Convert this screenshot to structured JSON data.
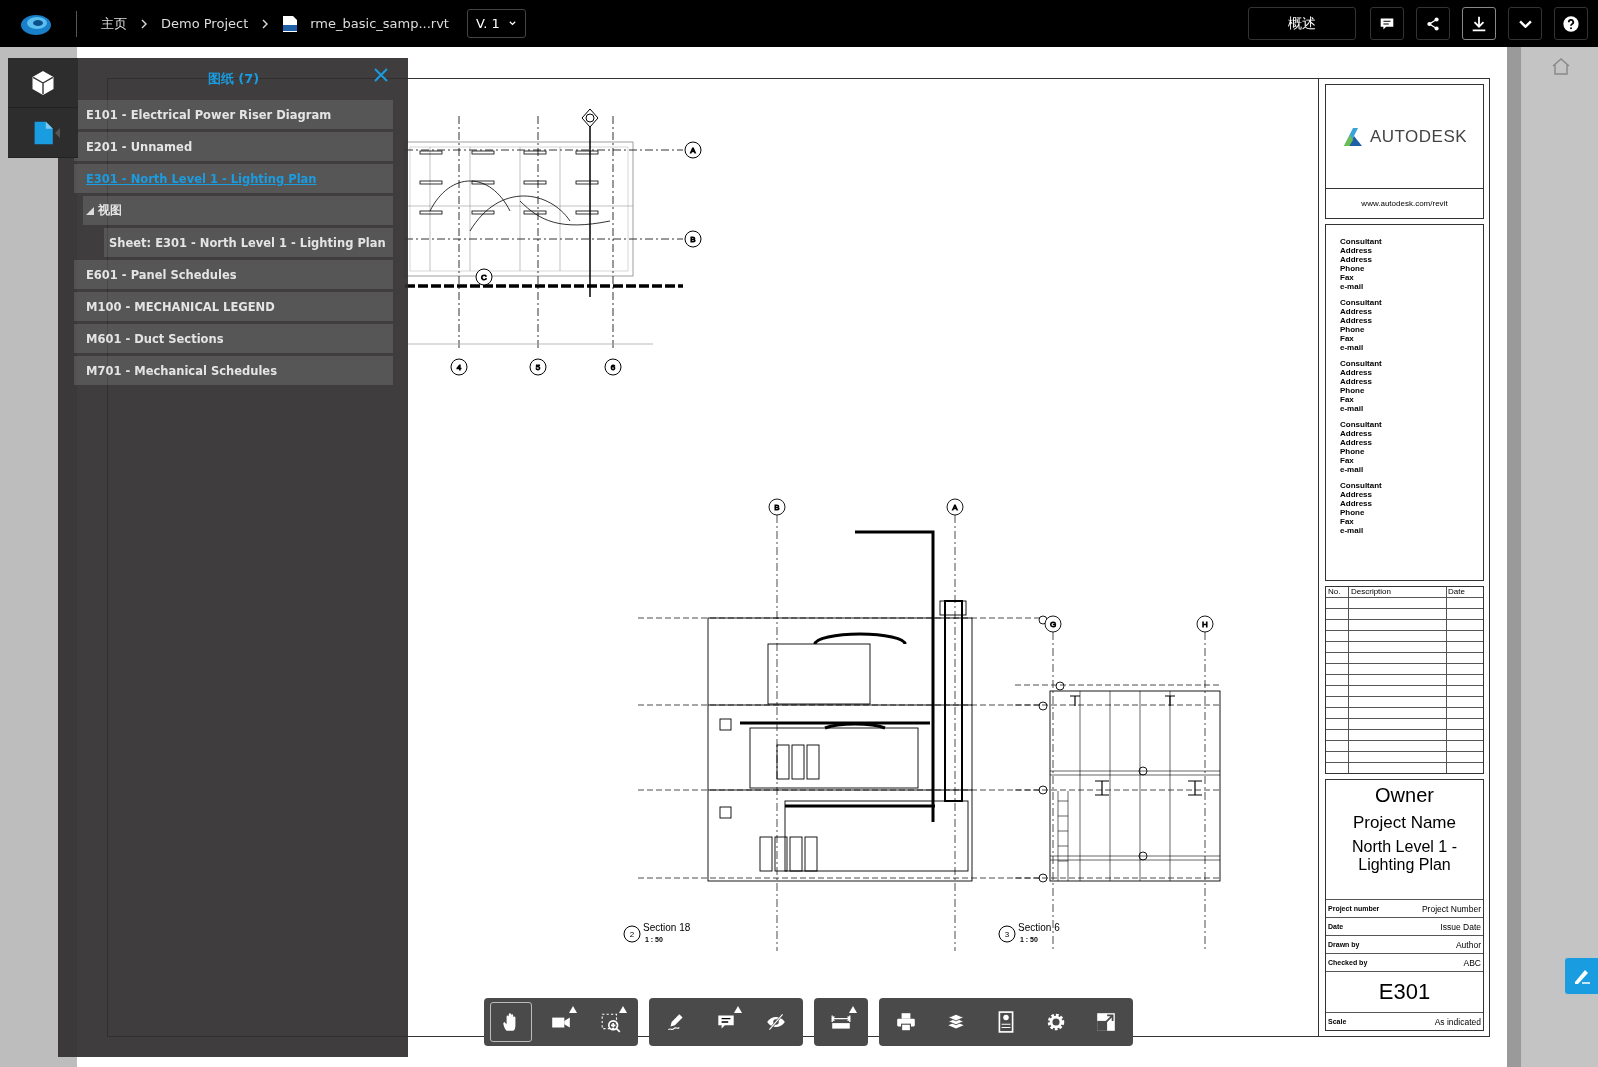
{
  "top_bar": {
    "breadcrumb": [
      {
        "kind": "link",
        "label": "主页"
      },
      {
        "kind": "link",
        "label": "Demo Project"
      },
      {
        "kind": "file",
        "label": "rme_basic_samp...rvt"
      }
    ],
    "version": "V. 1",
    "overview_button": "概述",
    "actions": [
      {
        "kind": "comment",
        "selected": false
      },
      {
        "kind": "share",
        "selected": false
      },
      {
        "kind": "download",
        "selected": true
      },
      {
        "kind": "more",
        "selected": false
      },
      {
        "kind": "help",
        "selected": false
      }
    ]
  },
  "side_tabs": [
    {
      "kind": "model",
      "selected": false
    },
    {
      "kind": "sheets",
      "selected": true
    }
  ],
  "sheets_panel": {
    "title": "图纸 (7)",
    "items": [
      {
        "label": "E101 - Electrical Power Riser Diagram",
        "selected": false
      },
      {
        "label": "E201 - Unnamed",
        "selected": false
      },
      {
        "label": "E301 - North Level 1 - Lighting Plan",
        "selected": true,
        "children": [
          {
            "label": "视图",
            "expanded": true,
            "children": [
              {
                "label": "Sheet: E301 - North Level 1 - Lighting Plan",
                "selected": false
              }
            ]
          }
        ]
      },
      {
        "label": "E601 - Panel Schedules",
        "selected": false
      },
      {
        "label": "M100 - MECHANICAL LEGEND",
        "selected": false
      },
      {
        "label": "M601 - Duct Sections",
        "selected": false
      },
      {
        "label": "M701 - Mechanical Schedules",
        "selected": false
      }
    ]
  },
  "sheet": {
    "plan": {
      "grid_labels": [
        "A",
        "B",
        "C",
        "4",
        "5",
        "6"
      ]
    },
    "sections": [
      {
        "number": "2",
        "title": "Section 18",
        "scale": "1 : 50",
        "grid_labels": [
          "B",
          "A"
        ]
      },
      {
        "number": "3",
        "title": "Section 6",
        "scale": "1 : 50",
        "grid_labels": [
          "G",
          "H"
        ]
      }
    ],
    "title_block": {
      "logo": "AUTODESK",
      "url": "www.autodesk.com/revit",
      "consultants": [
        {
          "lines": [
            "Consultant",
            "Address",
            "Address",
            "Phone",
            "Fax",
            "e-mail"
          ]
        },
        {
          "lines": [
            "Consultant",
            "Address",
            "Address",
            "Phone",
            "Fax",
            "e-mail"
          ]
        },
        {
          "lines": [
            "Consultant",
            "Address",
            "Address",
            "Phone",
            "Fax",
            "e-mail"
          ]
        },
        {
          "lines": [
            "Consultant",
            "Address",
            "Address",
            "Phone",
            "Fax",
            "e-mail"
          ]
        },
        {
          "lines": [
            "Consultant",
            "Address",
            "Address",
            "Phone",
            "Fax",
            "e-mail"
          ]
        }
      ],
      "revision_columns": [
        "No.",
        "Description",
        "Date"
      ],
      "owner": "Owner",
      "project_name": "Project Name",
      "sheet_name": "North Level 1 - Lighting Plan",
      "fields": [
        {
          "label": "Project number",
          "value": "Project Number"
        },
        {
          "label": "Date",
          "value": "Issue Date"
        },
        {
          "label": "Drawn by",
          "value": "Author"
        },
        {
          "label": "Checked by",
          "value": "ABC"
        }
      ],
      "sheet_number": "E301",
      "scale": {
        "label": "Scale",
        "value": "As indicated"
      }
    }
  },
  "toolbar": {
    "groups": [
      {
        "tools": [
          {
            "kind": "pan",
            "selected": true,
            "submenu": false
          },
          {
            "kind": "camera",
            "selected": false,
            "submenu": true
          },
          {
            "kind": "zoom-window",
            "selected": false,
            "submenu": true
          }
        ]
      },
      {
        "tools": [
          {
            "kind": "markup",
            "selected": false,
            "submenu": false
          },
          {
            "kind": "comment",
            "selected": false,
            "submenu": true
          },
          {
            "kind": "hide",
            "selected": false,
            "submenu": false
          }
        ]
      },
      {
        "tools": [
          {
            "kind": "measure",
            "selected": false,
            "submenu": true
          }
        ]
      },
      {
        "tools": [
          {
            "kind": "print",
            "selected": false,
            "submenu": false
          },
          {
            "kind": "layers",
            "selected": false,
            "submenu": false
          },
          {
            "kind": "properties",
            "selected": false,
            "submenu": false
          },
          {
            "kind": "settings",
            "selected": false,
            "submenu": false
          },
          {
            "kind": "fullscreen",
            "selected": false,
            "submenu": false
          }
        ]
      }
    ]
  }
}
